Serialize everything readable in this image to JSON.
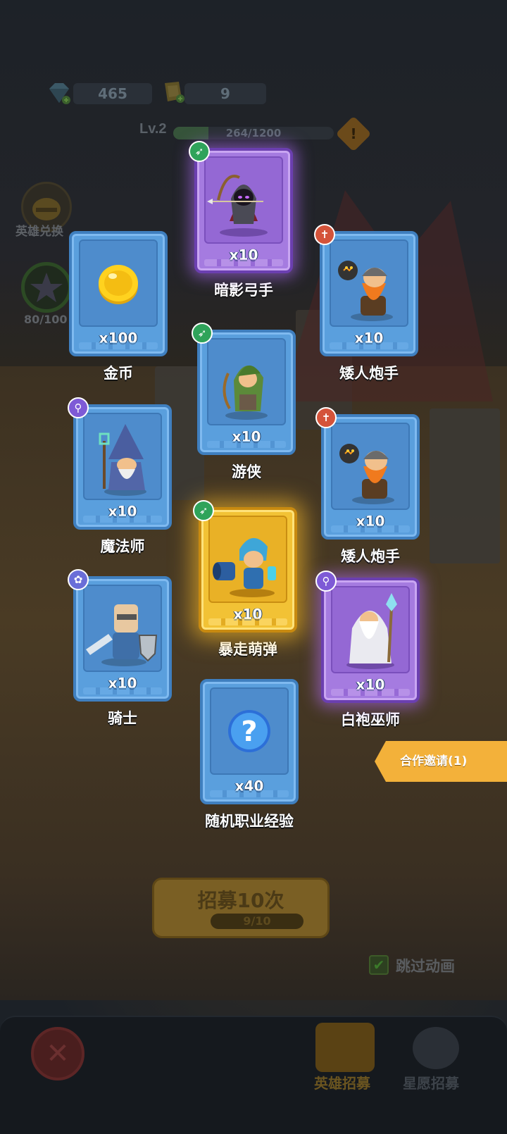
{
  "resources": {
    "gems": "465",
    "tickets": "9"
  },
  "level": {
    "label": "Lv.2",
    "xp_text": "264/1200",
    "xp_progress": 0.22
  },
  "side": {
    "hero_exchange_label": "英雄兑换",
    "star_progress_label": "80/100"
  },
  "rewards": [
    {
      "id": "shadow-archer",
      "name": "暗影弓手",
      "count": "x10",
      "rarity": "purple",
      "badge": "bow-icon"
    },
    {
      "id": "gold",
      "name": "金币",
      "count": "x100",
      "rarity": "blue",
      "badge": ""
    },
    {
      "id": "dwarf-gunner-1",
      "name": "矮人炮手",
      "count": "x10",
      "rarity": "blue",
      "badge": "fire-icon"
    },
    {
      "id": "ranger",
      "name": "游侠",
      "count": "x10",
      "rarity": "blue",
      "badge": "bow-icon"
    },
    {
      "id": "mage",
      "name": "魔法师",
      "count": "x10",
      "rarity": "blue",
      "badge": "magic-icon"
    },
    {
      "id": "dwarf-gunner-2",
      "name": "矮人炮手",
      "count": "x10",
      "rarity": "blue",
      "badge": "fire-icon"
    },
    {
      "id": "rampage-cannon",
      "name": "暴走萌弹",
      "count": "x10",
      "rarity": "gold",
      "badge": "bow-icon"
    },
    {
      "id": "knight",
      "name": "骑士",
      "count": "x10",
      "rarity": "blue",
      "badge": "paw-icon"
    },
    {
      "id": "white-wizard",
      "name": "白袍巫师",
      "count": "x10",
      "rarity": "purple",
      "badge": "magic-icon"
    },
    {
      "id": "random-exp",
      "name": "随机职业经验",
      "count": "x40",
      "rarity": "blue",
      "badge": ""
    }
  ],
  "invite": {
    "label": "合作邀请(1)"
  },
  "recruit": {
    "label": "招募10次",
    "progress": "9/10"
  },
  "skip": {
    "label": "跳过动画",
    "checked": true
  },
  "tabs": [
    {
      "label": "英雄招募",
      "active": true
    },
    {
      "label": "星愿招募",
      "active": false
    }
  ],
  "colors": {
    "blue_card": "#5a9fdd",
    "purple_card": "#a57be0",
    "gold_card": "#f2c235",
    "accent_orange": "#f3b13a"
  }
}
